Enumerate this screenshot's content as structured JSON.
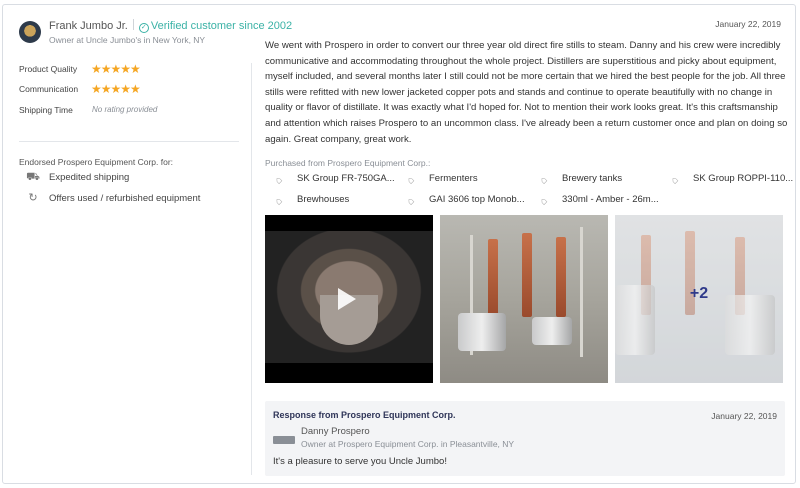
{
  "review": {
    "reviewer_name": "Frank Jumbo Jr.",
    "verified_text": "Verified customer since 2002",
    "reviewer_title": "Owner at Uncle Jumbo's in New York, NY",
    "date": "January 22, 2019",
    "ratings": [
      {
        "label": "Product Quality",
        "stars": 5
      },
      {
        "label": "Communication",
        "stars": 5
      },
      {
        "label": "Shipping Time",
        "none_text": "No rating provided"
      }
    ],
    "stars_text": "★★★★★",
    "endorse_title": "Endorsed Prospero Equipment Corp. for:",
    "endorsements": [
      {
        "label": "Expedited shipping",
        "icon": "truck-icon"
      },
      {
        "label": "Offers used / refurbished equipment",
        "icon": "refresh-icon"
      }
    ],
    "body": "We went with Prospero in order to convert our three year old direct fire stills to steam. Danny and his crew were incredibly communicative and accommodating throughout the whole project. Distillers are superstitious and picky about equipment, myself included, and several months later I still could not be more certain that we hired the best people for the job. All three stills were refitted with new lower jacketed copper pots and stands and continue to operate beautifully with no change in quality or flavor of distillate. It was exactly what I'd hoped for. Not to mention their work looks great. It's this craftsmanship and attention which raises Prospero to an uncommon class. I've already been a return customer once and plan on doing so again. Great company, great work.",
    "purchased_label": "Purchased from Prospero Equipment Corp.:",
    "tags": [
      "SK Group FR-750GA...",
      "Fermenters",
      "Brewery tanks",
      "SK Group ROPPI-110...",
      "Brewhouses",
      "GAI 3606 top Monob...",
      "330ml - Amber - 26m..."
    ],
    "more_photos": "+2"
  },
  "response": {
    "title": "Response from Prospero Equipment Corp.",
    "date": "January 22, 2019",
    "name": "Danny Prospero",
    "role": "Owner at Prospero Equipment Corp. in Pleasantville, NY",
    "text": "It's a pleasure to serve you Uncle Jumbo!"
  },
  "colors": {
    "accent": "#3bb2a6",
    "stars": "#f5a623",
    "response_title": "#2f3558"
  }
}
